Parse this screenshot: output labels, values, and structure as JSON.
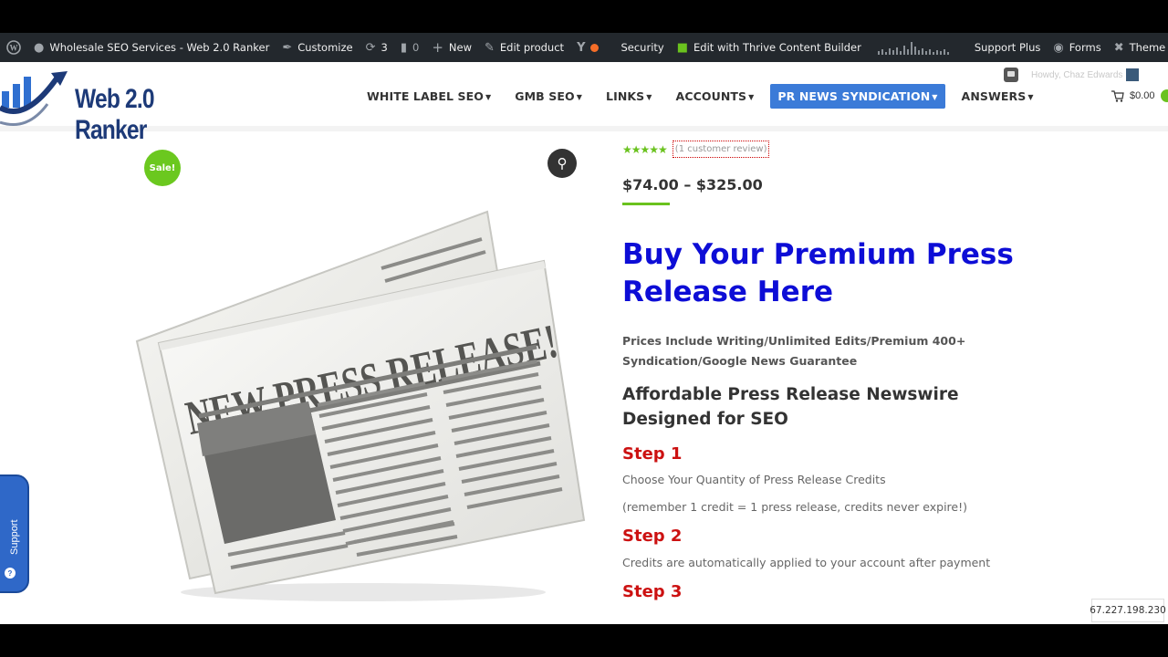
{
  "adminbar": {
    "site_name": "Wholesale SEO Services - Web 2.0 Ranker",
    "customize": "Customize",
    "updates_count": "3",
    "comments_count": "0",
    "new": "New",
    "edit_product": "Edit product",
    "security": "Security",
    "thrive": "Edit with Thrive Content Builder",
    "support_plus": "Support Plus",
    "forms": "Forms",
    "theme_options": "Theme Options"
  },
  "header": {
    "logo_text": "Web 2.0 Ranker",
    "nav": [
      {
        "label": "WHITE LABEL SEO"
      },
      {
        "label": "GMB SEO"
      },
      {
        "label": "LINKS"
      },
      {
        "label": "ACCOUNTS"
      },
      {
        "label": "PR NEWS SYNDICATION"
      },
      {
        "label": "ANSWERS"
      }
    ],
    "howdy": "Howdy, Chaz Edwards",
    "cart_total": "$0.00"
  },
  "product": {
    "sale_badge": "Sale!",
    "image_headline": "NEW PRESS RELEASE!",
    "review_link": "(1 customer review)",
    "rating": 5,
    "price": "$74.00 – $325.00",
    "title": "Buy Your Premium Press Release Here",
    "includes": "Prices Include Writing/Unlimited Edits/Premium 400+ Syndication/Google News Guarantee",
    "subtitle": "Affordable Press Release Newswire Designed for SEO",
    "step1_title": "Step 1",
    "step1_text": "Choose Your Quantity of Press Release Credits",
    "step1_note": "(remember 1 credit = 1 press release, credits never expire!)",
    "step2_title": "Step 2",
    "step2_text": "Credits are automatically applied to your account after payment",
    "step3_title": "Step 3"
  },
  "support_tab": "Support",
  "ip_address": "67.227.198.230",
  "colors": {
    "adminbar": "#23282d",
    "accent_blue": "#3b7bd8",
    "title_blue": "#0d0dd6",
    "step_red": "#cc1111",
    "sale_green": "#6bc81f"
  }
}
